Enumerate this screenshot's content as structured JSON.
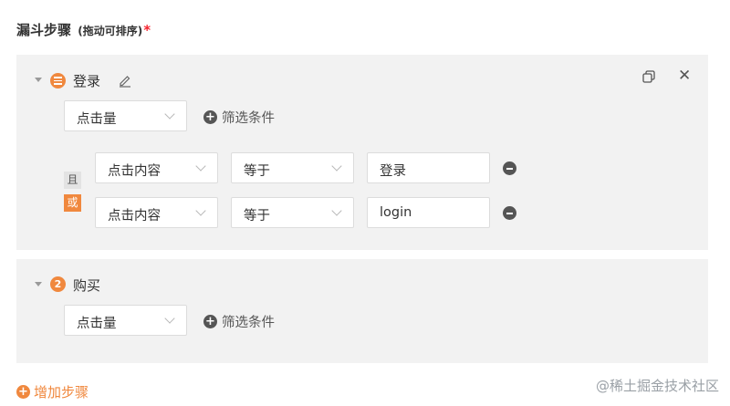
{
  "header": {
    "title": "漏斗步骤",
    "hint": "(拖动可排序)",
    "required_mark": "*"
  },
  "steps": [
    {
      "number": "",
      "name": "登录",
      "event_select": "点击量",
      "add_filter_label": "筛选条件",
      "logic_labels": [
        "且",
        "或"
      ],
      "filters": [
        {
          "property": "点击内容",
          "operator": "等于",
          "value": "登录"
        },
        {
          "property": "点击内容",
          "operator": "等于",
          "value": "login"
        }
      ]
    },
    {
      "number": "2",
      "name": "购买",
      "event_select": "点击量",
      "add_filter_label": "筛选条件"
    }
  ],
  "add_step_label": "增加步骤",
  "watermark": "@稀土掘金技术社区",
  "colors": {
    "accent": "#f0883e",
    "card_bg": "#f2f2f2",
    "required": "#f5222d"
  },
  "icons": [
    "caret-down-icon",
    "menu-icon",
    "edit-icon",
    "copy-icon",
    "close-icon",
    "plus-circle-icon",
    "minus-circle-icon",
    "chevron-down-icon"
  ]
}
